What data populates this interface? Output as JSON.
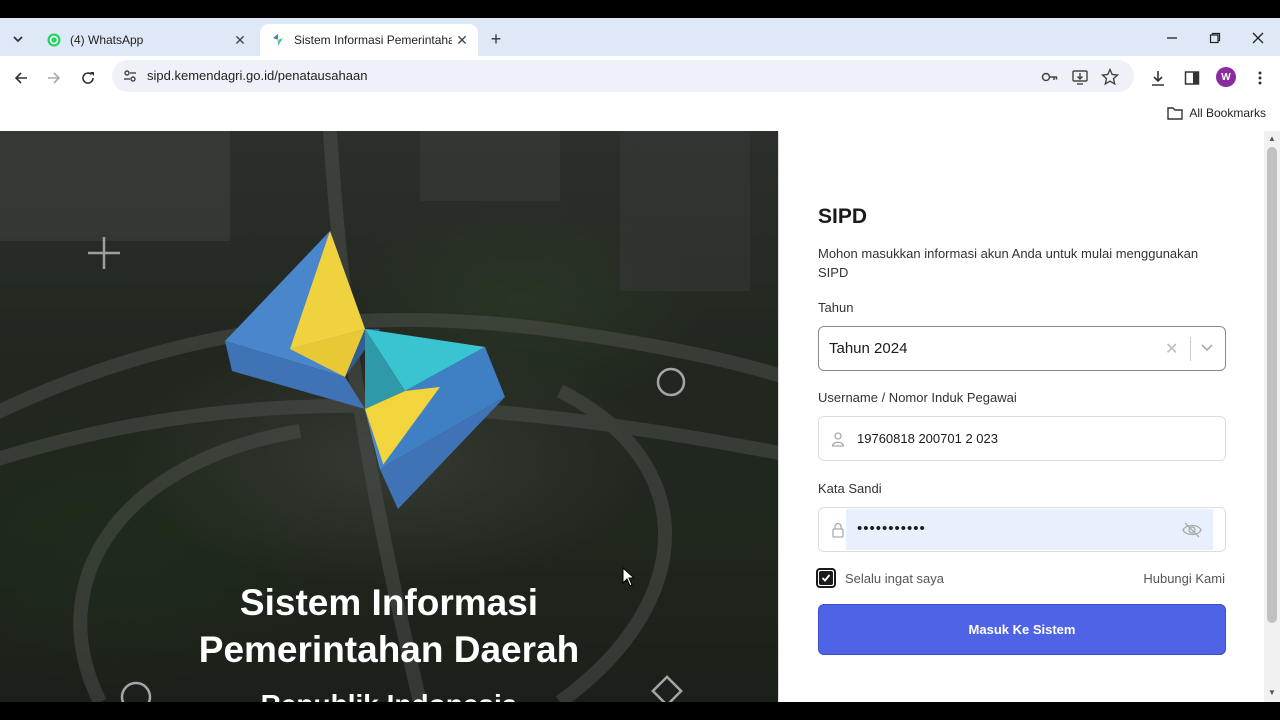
{
  "browser": {
    "tabs": [
      {
        "title": "(4) WhatsApp",
        "active": false
      },
      {
        "title": "Sistem Informasi Pemerintahan",
        "active": true
      }
    ],
    "url": "sipd.kemendagri.go.id/penatausahaan",
    "profile_initial": "W",
    "bookmarks_label": "All Bookmarks"
  },
  "hero": {
    "title_line1": "Sistem Informasi",
    "title_line2": "Pemerintahan Daerah",
    "subtitle": "Republik Indonesia"
  },
  "login": {
    "title": "SIPD",
    "description": "Mohon masukkan informasi akun Anda untuk mulai menggunakan SIPD",
    "year_label": "Tahun",
    "year_value": "Tahun 2024",
    "username_label": "Username / Nomor Induk Pegawai",
    "username_value": "19760818 200701 2 023",
    "password_label": "Kata Sandi",
    "password_value": "•••••••••••",
    "remember_label": "Selalu ingat saya",
    "remember_checked": true,
    "contact_link": "Hubungi Kami",
    "submit_label": "Masuk Ke Sistem"
  },
  "colors": {
    "primary_button": "#4f63e6",
    "logo_blue": "#3f7fc4",
    "logo_yellow": "#f2d43d",
    "logo_cyan": "#35c2cf"
  }
}
